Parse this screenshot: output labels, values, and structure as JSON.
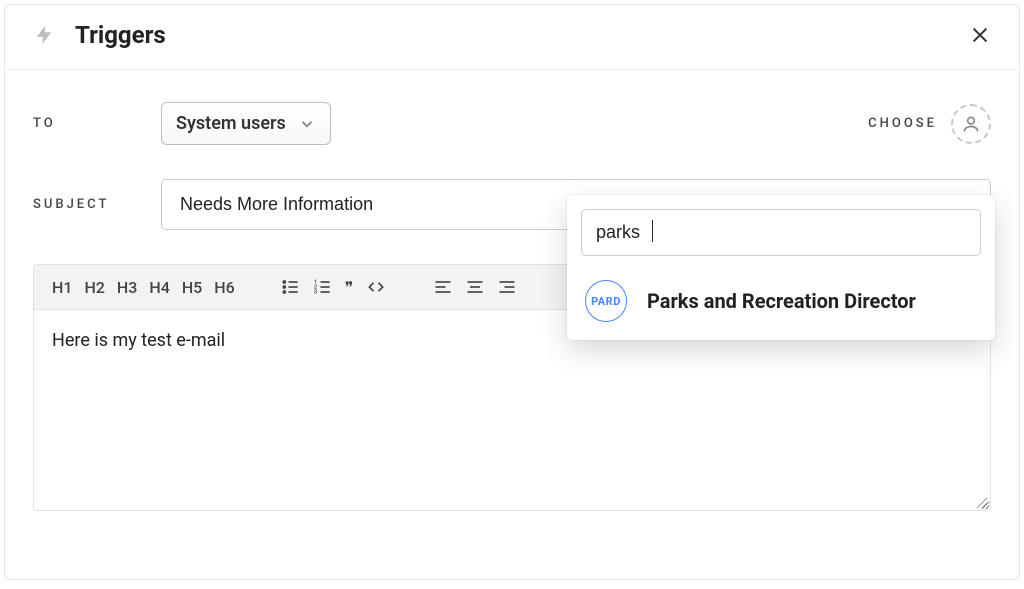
{
  "header": {
    "title": "Triggers"
  },
  "form": {
    "to_label": "TO",
    "to_value": "System users",
    "choose_label": "CHOOSE",
    "subject_label": "SUBJECT",
    "subject_value": "Needs More Information"
  },
  "toolbar": {
    "h1": "H1",
    "h2": "H2",
    "h3": "H3",
    "h4": "H4",
    "h5": "H5",
    "h6": "H6",
    "ul": "bulleted-list",
    "ol": "numbered-list",
    "quote": "❞",
    "code": "<>",
    "align_left": "align-left",
    "align_center": "align-center",
    "align_right": "align-right"
  },
  "editor": {
    "body": "Here is my test e-mail"
  },
  "popover": {
    "search_value": "parks",
    "result_badge": "PARD",
    "result_label": "Parks and Recreation Director"
  }
}
